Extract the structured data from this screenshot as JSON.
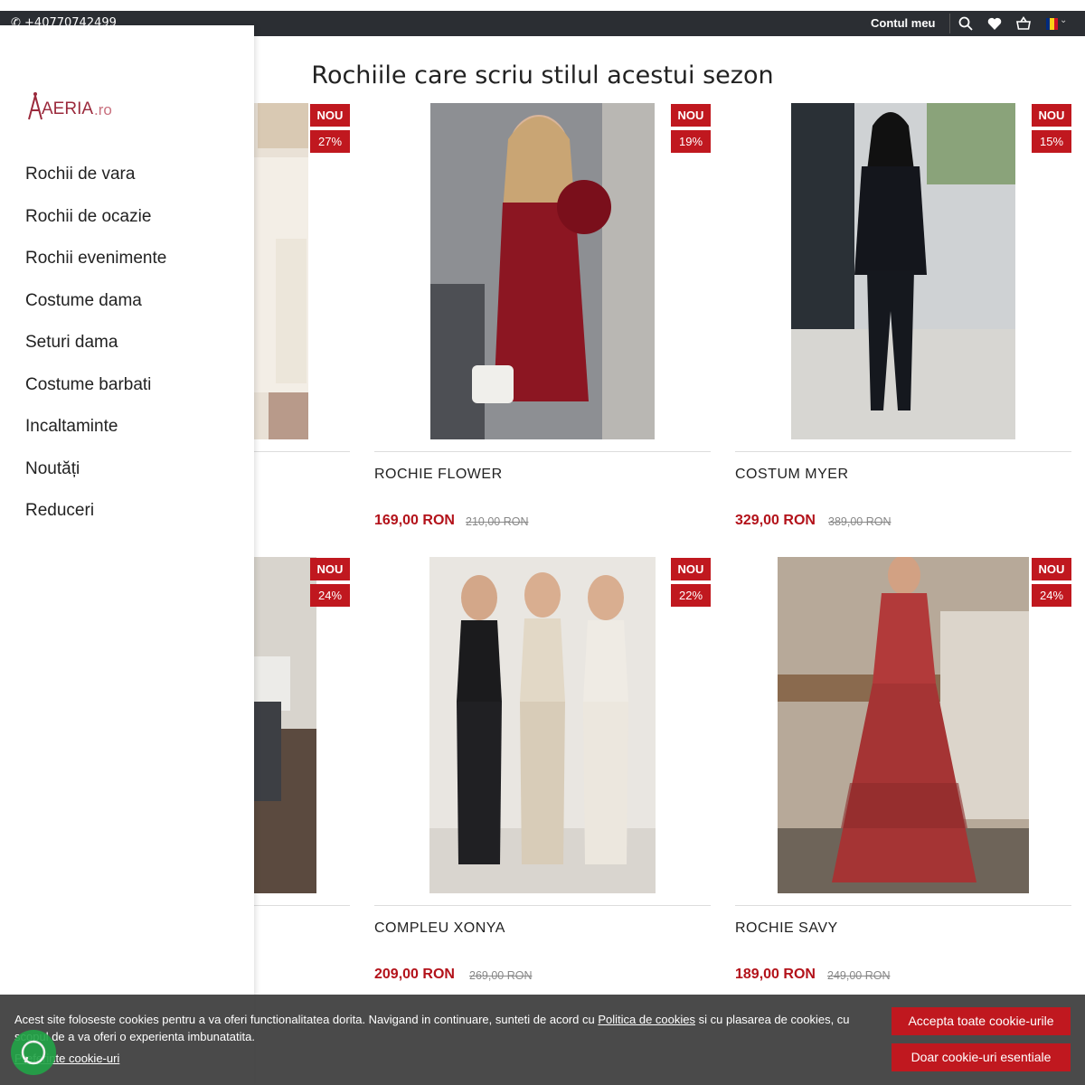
{
  "topbar": {
    "phone": "+40770742499",
    "account": "Contul meu",
    "icons": [
      "search-icon",
      "heart-icon",
      "basket-icon",
      "flag-romania-icon"
    ]
  },
  "heading": "Rochiile care scriu stilul acestui sezon",
  "logo": {
    "text_brand": "AERIA",
    "text_tld": ".ro"
  },
  "menu": [
    "Rochii de vara",
    "Rochii de ocazie",
    "Rochii evenimente",
    "Costume dama",
    "Seturi dama",
    "Costume barbati",
    "Incaltaminte",
    "Noutăți",
    "Reduceri"
  ],
  "products": [
    {
      "name": "",
      "price": "",
      "old_price": "",
      "badge_new": "NOU",
      "badge_off": "27%"
    },
    {
      "name": "ROCHIE FLOWER",
      "price": "169,00 RON",
      "old_price": "210,00 RON",
      "badge_new": "NOU",
      "badge_off": "19%"
    },
    {
      "name": "COSTUM MYER",
      "price": "329,00 RON",
      "old_price": "389,00 RON",
      "badge_new": "NOU",
      "badge_off": "15%"
    },
    {
      "name": "",
      "price": "",
      "old_price": "",
      "badge_new": "NOU",
      "badge_off": "24%"
    },
    {
      "name": "COMPLEU XONYA",
      "price": "209,00 RON",
      "old_price": "269,00 RON",
      "badge_new": "NOU",
      "badge_off": "22%"
    },
    {
      "name": "ROCHIE SAVY",
      "price": "189,00 RON",
      "old_price": "249,00 RON",
      "badge_new": "NOU",
      "badge_off": "24%"
    }
  ],
  "cookie": {
    "text_before": "Acest site foloseste cookies pentru a va oferi functionalitatea dorita. Navigand in continuare, sunteti de acord cu ",
    "policy_link": "Politica de cookies",
    "text_after": " si cu plasarea de cookies, cu scopul de a va oferi o experienta imbunatatita.",
    "preferences": "Preferinte cookie-uri",
    "accept_all": "Accepta toate cookie-urile",
    "essential_only": "Doar cookie-uri esentiale"
  },
  "colors": {
    "accent": "#c0181f",
    "topbar": "#2b2e33",
    "price": "#b3121a"
  }
}
